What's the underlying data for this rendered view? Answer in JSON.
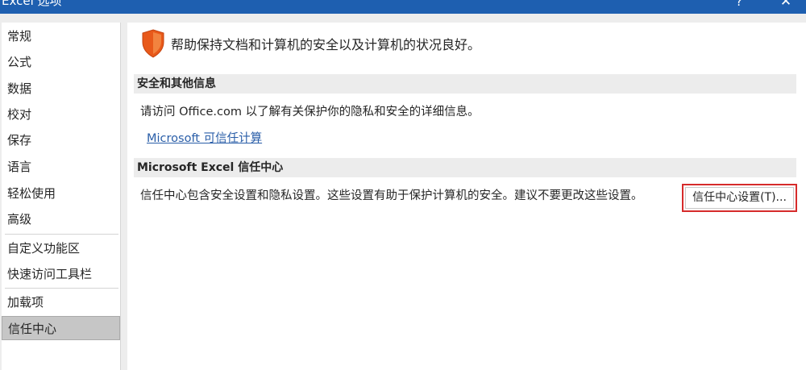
{
  "window": {
    "title": "Excel 选项",
    "help_label": "?",
    "close_label": "✕"
  },
  "sidebar": {
    "items": [
      {
        "label": "常规"
      },
      {
        "label": "公式"
      },
      {
        "label": "数据"
      },
      {
        "label": "校对"
      },
      {
        "label": "保存"
      },
      {
        "label": "语言"
      },
      {
        "label": "轻松使用"
      },
      {
        "label": "高级"
      },
      {
        "label": "自定义功能区"
      },
      {
        "label": "快速访问工具栏"
      },
      {
        "label": "加载项"
      },
      {
        "label": "信任中心"
      }
    ],
    "active": "信任中心"
  },
  "main": {
    "headline": "帮助保持文档和计算机的安全以及计算机的状况良好。",
    "section_privacy": {
      "title": "安全和其他信息",
      "text": "请访问 Office.com 以了解有关保护你的隐私和安全的详细信息。",
      "link": "Microsoft 可信任计算"
    },
    "section_trust_center": {
      "title": "Microsoft Excel 信任中心",
      "text": "信任中心包含安全设置和隐私设置。这些设置有助于保护计算机的安全。建议不要更改这些设置。",
      "button": "信任中心设置(T)..."
    }
  },
  "colors": {
    "titlebar": "#1e5fb0",
    "shield": "#e8591a",
    "link": "#2a5ea8",
    "highlight_border": "#d62b2b"
  },
  "icons": {
    "shield": "shield-icon"
  }
}
